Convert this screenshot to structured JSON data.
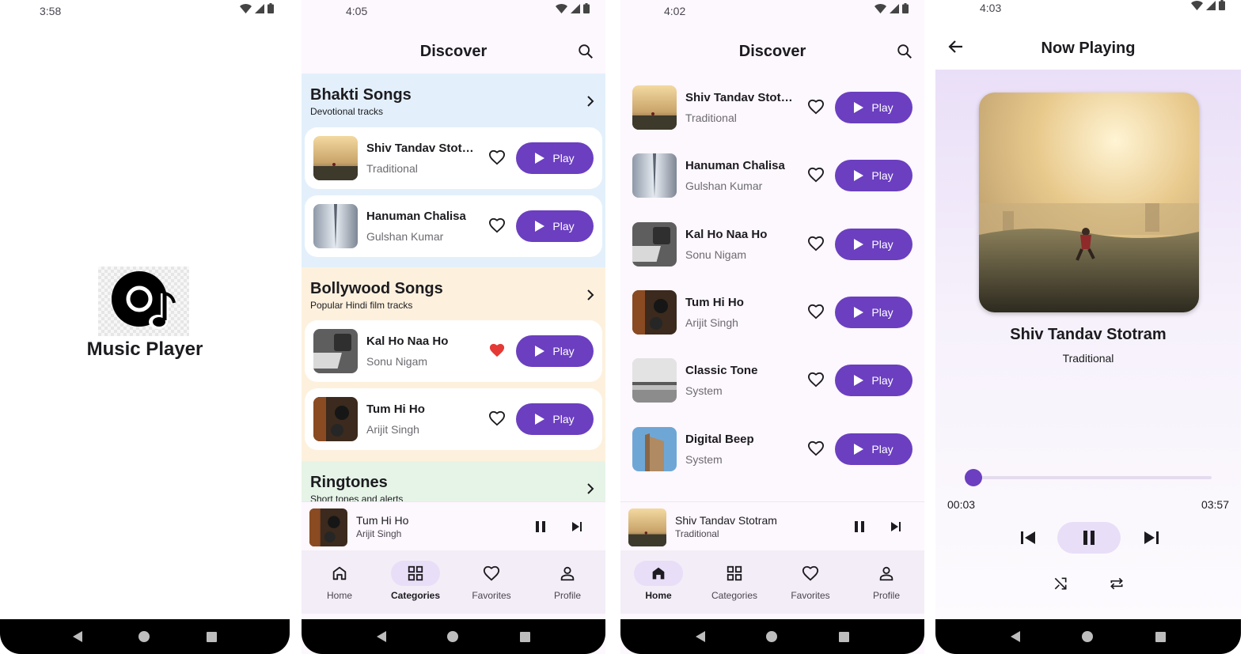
{
  "splash": {
    "time": "3:58",
    "app_title": "Music Player",
    "logo_icon": "vinyl-music-note-icon"
  },
  "categories_screen": {
    "time": "4:05",
    "title": "Discover",
    "sections": [
      {
        "title": "Bhakti Songs",
        "subtitle": "Devotional tracks",
        "color": "#e3f0fb",
        "songs": [
          {
            "title": "Shiv Tandav Stotr…",
            "artist": "Traditional",
            "favorite": false,
            "play_label": "Play"
          },
          {
            "title": "Hanuman Chalisa",
            "artist": "Gulshan Kumar",
            "favorite": false,
            "play_label": "Play"
          }
        ]
      },
      {
        "title": "Bollywood Songs",
        "subtitle": "Popular Hindi film tracks",
        "color": "#fdf1de",
        "songs": [
          {
            "title": "Kal Ho Naa Ho",
            "artist": "Sonu Nigam",
            "favorite": true,
            "play_label": "Play"
          },
          {
            "title": "Tum Hi Ho",
            "artist": "Arijit Singh",
            "favorite": false,
            "play_label": "Play"
          }
        ]
      },
      {
        "title": "Ringtones",
        "subtitle": "Short tones and alerts",
        "color": "#e6f4e8",
        "songs": []
      }
    ],
    "mini_player": {
      "title": "Tum Hi Ho",
      "artist": "Arijit Singh"
    },
    "active_tab": "Categories"
  },
  "home_screen": {
    "time": "4:02",
    "title": "Discover",
    "songs": [
      {
        "title": "Shiv Tandav Stotr…",
        "artist": "Traditional",
        "favorite": false,
        "play_label": "Play"
      },
      {
        "title": "Hanuman Chalisa",
        "artist": "Gulshan Kumar",
        "favorite": false,
        "play_label": "Play"
      },
      {
        "title": "Kal Ho Naa Ho",
        "artist": "Sonu Nigam",
        "favorite": false,
        "play_label": "Play"
      },
      {
        "title": "Tum Hi Ho",
        "artist": "Arijit Singh",
        "favorite": false,
        "play_label": "Play"
      },
      {
        "title": "Classic Tone",
        "artist": "System",
        "favorite": false,
        "play_label": "Play"
      },
      {
        "title": "Digital Beep",
        "artist": "System",
        "favorite": false,
        "play_label": "Play"
      }
    ],
    "mini_player": {
      "title": "Shiv Tandav Stotram",
      "artist": "Traditional"
    },
    "active_tab": "Home"
  },
  "nav_tabs": [
    {
      "label": "Home",
      "icon": "home-icon"
    },
    {
      "label": "Categories",
      "icon": "grid-icon"
    },
    {
      "label": "Favorites",
      "icon": "heart-icon"
    },
    {
      "label": "Profile",
      "icon": "person-icon"
    }
  ],
  "now_playing": {
    "time": "4:03",
    "title": "Now Playing",
    "song": "Shiv Tandav Stotram",
    "artist": "Traditional",
    "current_time": "00:03",
    "total_time": "03:57",
    "progress": 0.013
  },
  "colors": {
    "accent": "#6b3fc0",
    "favorite": "#e53935",
    "nav_bg": "#f3edf7",
    "nav_active": "#e8def8"
  }
}
